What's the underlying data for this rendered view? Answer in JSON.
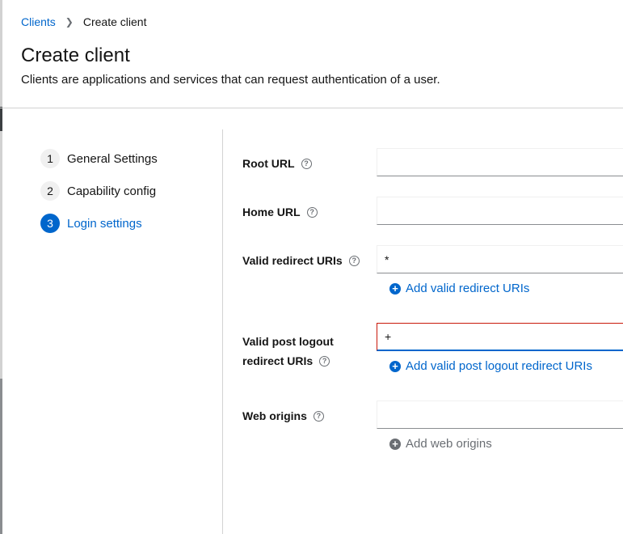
{
  "breadcrumb": {
    "parent": "Clients",
    "current": "Create client"
  },
  "header": {
    "title": "Create client",
    "description": "Clients are applications and services that can request authentication of a user."
  },
  "wizard": {
    "steps": [
      {
        "number": "1",
        "label": "General Settings"
      },
      {
        "number": "2",
        "label": "Capability config"
      },
      {
        "number": "3",
        "label": "Login settings"
      }
    ]
  },
  "form": {
    "help_glyph": "?",
    "root_url": {
      "label": "Root URL",
      "value": ""
    },
    "home_url": {
      "label": "Home URL",
      "value": ""
    },
    "valid_redirect": {
      "label": "Valid redirect URIs",
      "value": "*",
      "add_label": "Add valid redirect URIs"
    },
    "post_logout": {
      "label_line1": "Valid post logout",
      "label_line2": "redirect URIs",
      "value": "+",
      "add_label": "Add valid post logout redirect URIs"
    },
    "web_origins": {
      "label": "Web origins",
      "value": "",
      "add_label": "Add web origins"
    }
  },
  "colors": {
    "link": "#0066cc",
    "active_step": "#0066cc",
    "focused_border": "#c9190b",
    "disabled": "#6a6e73"
  }
}
